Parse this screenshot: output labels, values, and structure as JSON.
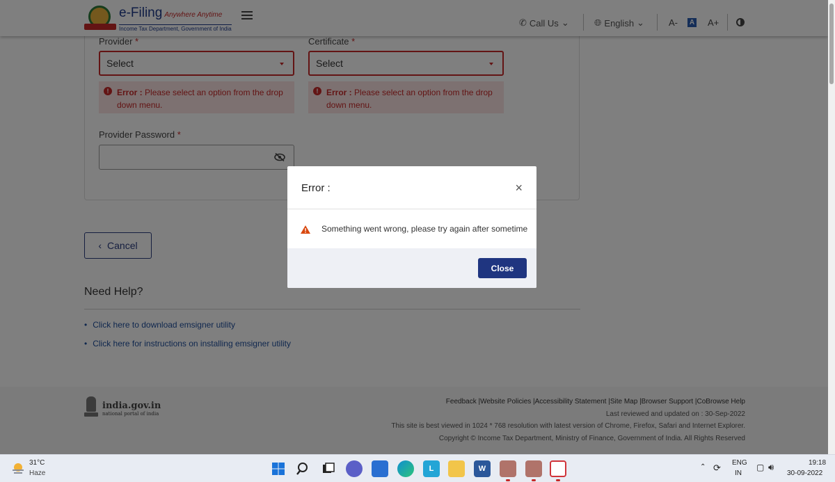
{
  "header": {
    "brand_title": "e-Filing",
    "brand_tagline": "Anywhere Anytime",
    "brand_subtitle": "Income Tax Department, Government of India",
    "call_us": "Call Us",
    "language": "English",
    "font_decrease": "A-",
    "font_default": "A",
    "font_increase": "A+"
  },
  "form": {
    "provider_label": "Provider",
    "certificate_label": "Certificate",
    "required_mark": "*",
    "provider_value": "Select",
    "certificate_value": "Select",
    "error_prefix": "Error :",
    "error_text": "Please select an option from the drop down menu.",
    "password_label": "Provider Password",
    "password_value": ""
  },
  "actions": {
    "cancel_label": "Cancel"
  },
  "help": {
    "title": "Need Help?",
    "links": [
      "Click here to download emsigner utility",
      "Click here for instructions on installing emsigner utility"
    ]
  },
  "footer": {
    "gov_name": "india.gov.in",
    "gov_sub": "national portal of india",
    "links": "Feedback |Website Policies |Accessibility Statement |Site Map |Browser Support |CoBrowse Help",
    "reviewed": "Last reviewed and updated on : 30-Sep-2022",
    "best_viewed": "This site is best viewed in 1024 * 768 resolution with latest version of Chrome, Firefox, Safari and Internet Explorer.",
    "copyright": "Copyright © Income Tax Department, Ministry of Finance, Government of India. All Rights Reserved"
  },
  "modal": {
    "title": "Error :",
    "message": "Something went wrong, please try again after sometime",
    "close_label": "Close",
    "close_icon": "×"
  },
  "taskbar": {
    "weather_temp": "31°C",
    "weather_desc": "Haze",
    "lang_top": "ENG",
    "lang_bottom": "IN",
    "time": "19:18",
    "date": "30-09-2022"
  },
  "colors": {
    "error": "#c62828",
    "primary": "#1f3580",
    "link": "#1f4e9c"
  }
}
